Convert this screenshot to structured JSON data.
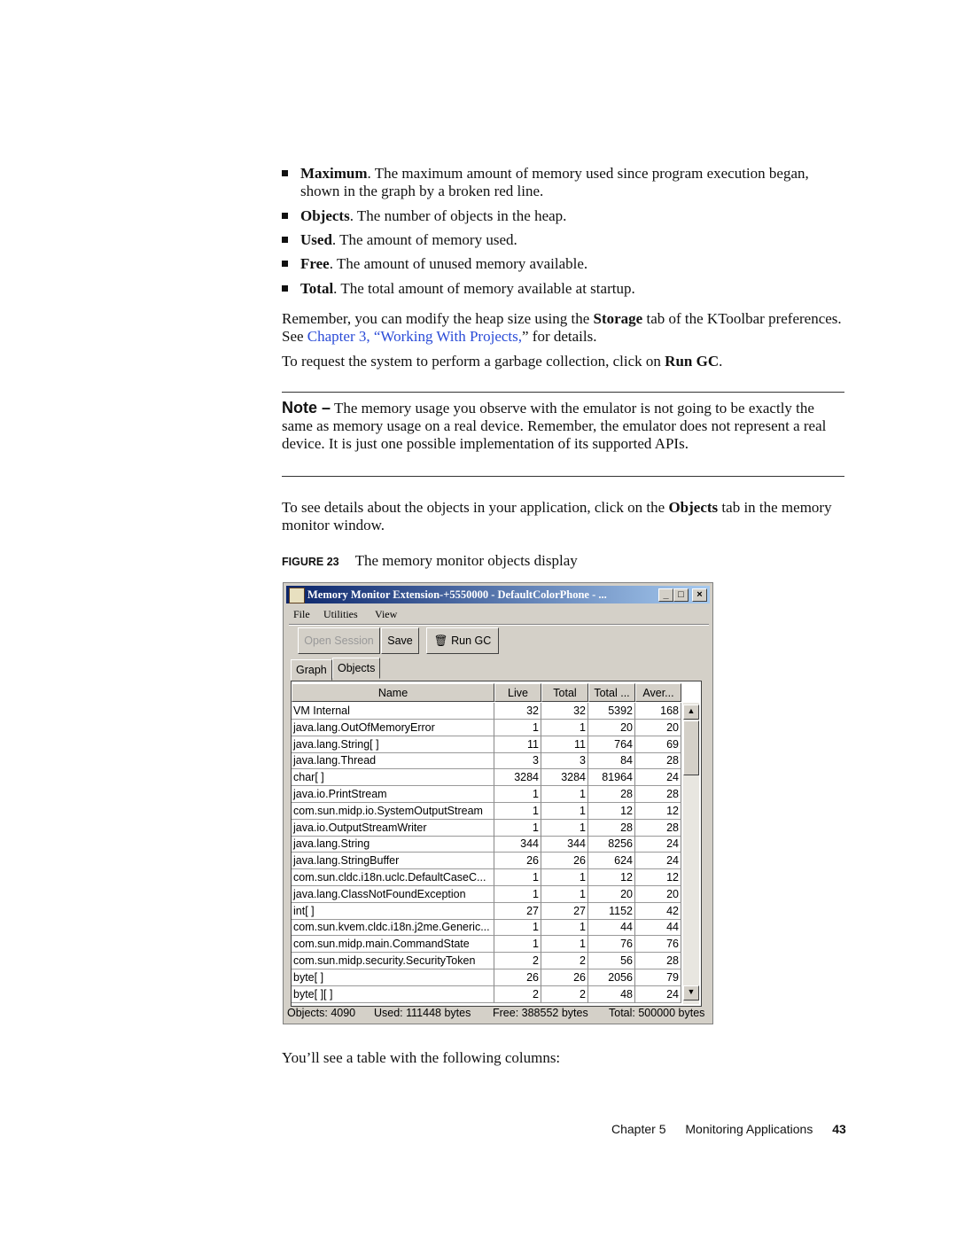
{
  "bullets": [
    {
      "term": "Maximum",
      "text": ". The maximum amount of memory used since program execution began, shown in the graph by a broken red line."
    },
    {
      "term": "Objects",
      "text": ". The number of objects in the heap."
    },
    {
      "term": "Used",
      "text": ". The amount of memory used."
    },
    {
      "term": "Free",
      "text": ". The amount of unused memory available."
    },
    {
      "term": "Total",
      "text": ". The total amount of memory available at startup."
    }
  ],
  "para1": {
    "a": "Remember, you can modify the heap size using the ",
    "b": "Storage",
    "c": " tab of the KToolbar preferences. See ",
    "link": "Chapter 3, “Working With Projects,",
    "d": "” for details."
  },
  "para2": {
    "a": "To request the system to perform a garbage collection, click on ",
    "b": "Run GC",
    "c": "."
  },
  "note": {
    "label": "Note –",
    "text": " The memory usage you observe with the emulator is not going to be exactly the same as memory usage on a real device. Remember, the emulator does not represent a real device. It is just one possible implementation of its supported APIs."
  },
  "para3": {
    "a": "To see details about the objects in your application, click on the ",
    "b": "Objects",
    "c": " tab in the memory monitor window."
  },
  "figure": {
    "label": "FIGURE 23",
    "caption": "The memory monitor objects display"
  },
  "window": {
    "title": "Memory Monitor Extension-+5550000 - DefaultColorPhone - ...",
    "menu": [
      "File",
      "Utilities",
      "View"
    ],
    "toolbar": {
      "open": "Open Session",
      "save": "Save",
      "rungc": "Run GC"
    },
    "tabs": [
      "Graph",
      "Objects"
    ],
    "columns": [
      "Name",
      "Live",
      "Total",
      "Total ...",
      "Aver..."
    ],
    "rows": [
      [
        "VM Internal",
        "32",
        "32",
        "5392",
        "168"
      ],
      [
        "java.lang.OutOfMemoryError",
        "1",
        "1",
        "20",
        "20"
      ],
      [
        "java.lang.String[ ]",
        "11",
        "11",
        "764",
        "69"
      ],
      [
        "java.lang.Thread",
        "3",
        "3",
        "84",
        "28"
      ],
      [
        "char[ ]",
        "3284",
        "3284",
        "81964",
        "24"
      ],
      [
        "java.io.PrintStream",
        "1",
        "1",
        "28",
        "28"
      ],
      [
        "com.sun.midp.io.SystemOutputStream",
        "1",
        "1",
        "12",
        "12"
      ],
      [
        "java.io.OutputStreamWriter",
        "1",
        "1",
        "28",
        "28"
      ],
      [
        "java.lang.String",
        "344",
        "344",
        "8256",
        "24"
      ],
      [
        "java.lang.StringBuffer",
        "26",
        "26",
        "624",
        "24"
      ],
      [
        "com.sun.cldc.i18n.uclc.DefaultCaseC...",
        "1",
        "1",
        "12",
        "12"
      ],
      [
        "java.lang.ClassNotFoundException",
        "1",
        "1",
        "20",
        "20"
      ],
      [
        "int[ ]",
        "27",
        "27",
        "1152",
        "42"
      ],
      [
        "com.sun.kvem.cldc.i18n.j2me.Generic...",
        "1",
        "1",
        "44",
        "44"
      ],
      [
        "com.sun.midp.main.CommandState",
        "1",
        "1",
        "76",
        "76"
      ],
      [
        "com.sun.midp.security.SecurityToken",
        "2",
        "2",
        "56",
        "28"
      ],
      [
        "byte[ ]",
        "26",
        "26",
        "2056",
        "79"
      ],
      [
        "byte[ ][ ]",
        "2",
        "2",
        "48",
        "24"
      ]
    ],
    "status": {
      "objects": "Objects: 4090",
      "used": "Used: 111448 bytes",
      "free": "Free: 388552 bytes",
      "total": "Total: 500000 bytes"
    }
  },
  "para4": "You’ll see a table with the following columns:",
  "footer": {
    "chapter": "Chapter 5",
    "section": "Monitoring Applications",
    "page": "43"
  }
}
